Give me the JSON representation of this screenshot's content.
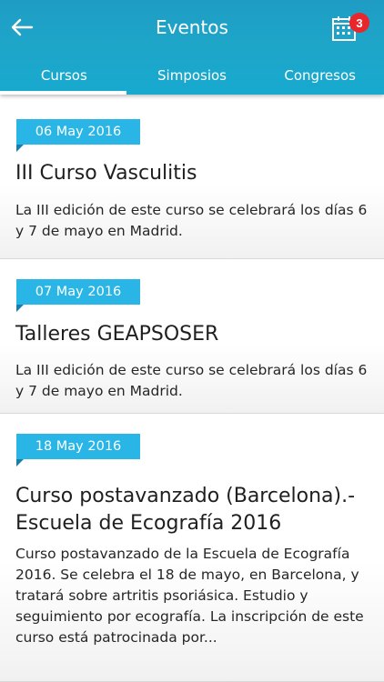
{
  "header": {
    "title": "Eventos",
    "back_icon": "arrow-left-icon",
    "calendar_icon": "calendar-icon",
    "notification_count": "3"
  },
  "tabs": [
    {
      "label": "Cursos",
      "active": true
    },
    {
      "label": "Simposios",
      "active": false
    },
    {
      "label": "Congresos",
      "active": false
    }
  ],
  "events": [
    {
      "date": "06 May 2016",
      "title": "III Curso Vasculitis",
      "description": "La III edición de este curso se celebrará los días 6 y 7 de mayo en Madrid."
    },
    {
      "date": "07 May 2016",
      "title": "Talleres GEAPSOSER",
      "description": "La III edición de este curso se celebrará los días 6 y 7 de mayo en Madrid."
    },
    {
      "date": "18 May 2016",
      "title": "Curso postavanzado (Barcelona).- Escuela de Ecografía 2016",
      "description": "Curso postavanzado de la Escuela de Ecografía 2016. Se celebra el 18 de mayo, en Barcelona, y tratará sobre artritis psoriásica. Estudio y seguimiento por ecografía. La inscripción de este curso está patrocinada por..."
    }
  ],
  "colors": {
    "appbar": "#1ea6c9",
    "date_tag": "#29b5e5",
    "badge": "#e8262b"
  }
}
